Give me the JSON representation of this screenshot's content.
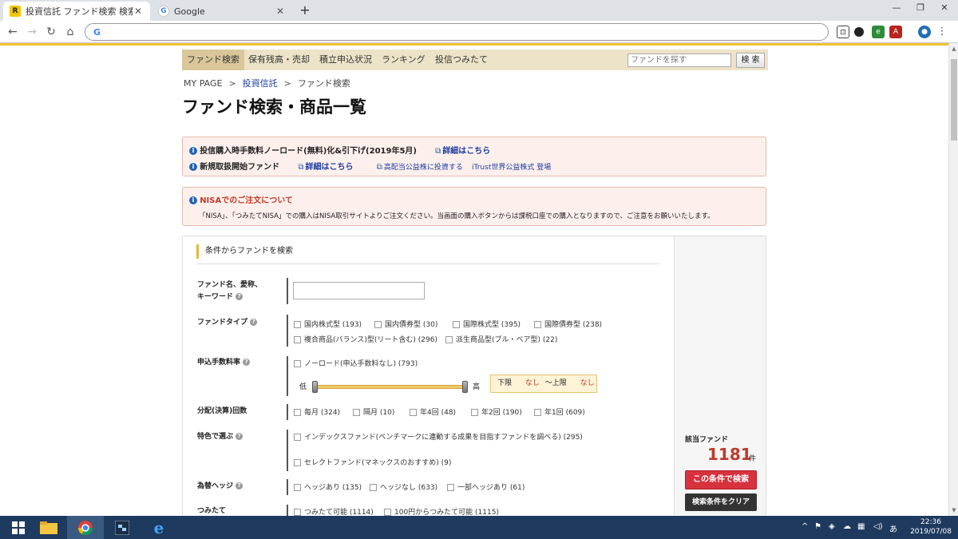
{
  "browser": {
    "tabs": [
      {
        "title": "投資信託 ファンド検索 検索結果",
        "active": true
      },
      {
        "title": "Google",
        "active": false
      }
    ],
    "new_tab": "+",
    "window_controls": [
      "—",
      "❐",
      "✕"
    ],
    "address": ""
  },
  "site_nav": {
    "items": [
      "ファンド検索",
      "保有残高・売却",
      "積立申込状況",
      "ランキング",
      "投信つみたて"
    ],
    "search_placeholder": "ファンドを探す",
    "search_button": "検 索"
  },
  "breadcrumb": [
    "MY PAGE",
    "投資信託",
    "ファンド検索"
  ],
  "page_title": "ファンド検索・商品一覧",
  "notices": {
    "line1_text": "投信購入時手数料ノーロード(無料)化&引下げ(2019年5月)",
    "line1_link": "詳細はこちら",
    "line2_text": "新規取扱開始ファンド",
    "line2_link": "詳細はこちら",
    "line2_ext1": "高配当公益株に投資する",
    "line2_ext2": "iTrust世界公益株式 登場",
    "nisa_title": "NISAでのご注文について",
    "nisa_body": "「NISA」、「つみたてNISA」での購入はNISA取引サイトよりご注文ください。当画面の購入ボタンからは課税口座での購入となりますので、ご注意をお願いいたします。"
  },
  "search": {
    "heading": "条件からファンドを検索",
    "rows": {
      "keyword_label_1": "ファンド名、愛称、",
      "keyword_label_2": "キーワード",
      "fund_type_label": "ファンドタイプ",
      "fund_types": [
        "国内株式型 (193)",
        "国内債券型 (30)",
        "国際株式型 (395)",
        "国際債券型 (238)",
        "複合商品(バランス)型(リート含む) (296)",
        "派生商品型(ブル・ベア型) (22)"
      ],
      "fee_label": "申込手数料率",
      "fee_noload": "ノーロード(申込手数料なし) (793)",
      "slider_low": "低",
      "slider_high": "高",
      "range_lower": "下限",
      "range_lower_val": "なし",
      "range_sep": "～上限",
      "range_upper_val": "なし",
      "dividend_label": "分配(決算)回数",
      "dividend_opts": [
        "毎月 (324)",
        "隔月 (10)",
        "年4回 (48)",
        "年2回 (190)",
        "年1回 (609)"
      ],
      "feature_label": "特色で選ぶ",
      "feature_opts": [
        "インデックスファンド(ベンチマークに連動する成果を目指すファンドを調べる) (295)",
        "セレクトファンド(マネックスのおすすめ) (9)"
      ],
      "hedge_label": "為替ヘッジ",
      "hedge_opts": [
        "ヘッジあり (135)",
        "ヘッジなし (633)",
        "一部ヘッジあり (61)"
      ],
      "tsumitate_label": "つみたて",
      "tsumitate_opts": [
        "つみたて可能 (1114)",
        "100円からつみたて可能 (1115)"
      ]
    },
    "result_label": "該当ファンド",
    "result_count": "1181",
    "result_unit": "件",
    "search_button": "この条件で検索",
    "clear_button": "検索条件をクリア"
  },
  "taskbar": {
    "ime": "あ",
    "time": "22:36",
    "date": "2019/07/08"
  },
  "colors": {
    "accent_red": "#d7323d",
    "nav_bg": "#ece3c8",
    "notice_bg": "#fdf0ec",
    "link_blue": "#1a3aa0"
  }
}
